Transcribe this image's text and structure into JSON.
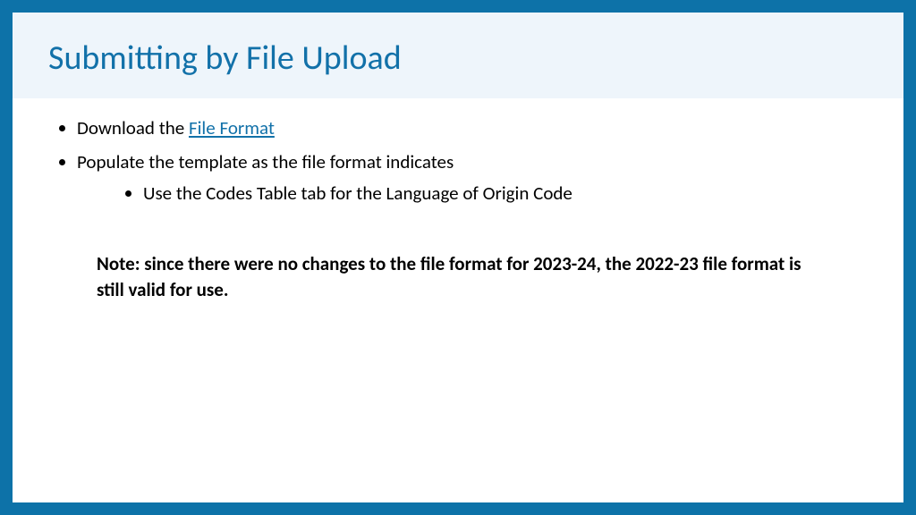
{
  "title": "Submitting by File Upload",
  "bullets": {
    "b1_prefix": "Download the ",
    "b1_link": "File Format",
    "b2": "Populate the template as the file format indicates",
    "b2_sub1": "Use the Codes Table tab for the Language of Origin Code"
  },
  "note": "Note: since there were no changes to the file format for 2023-24, the 2022-23 file format is still valid for use."
}
